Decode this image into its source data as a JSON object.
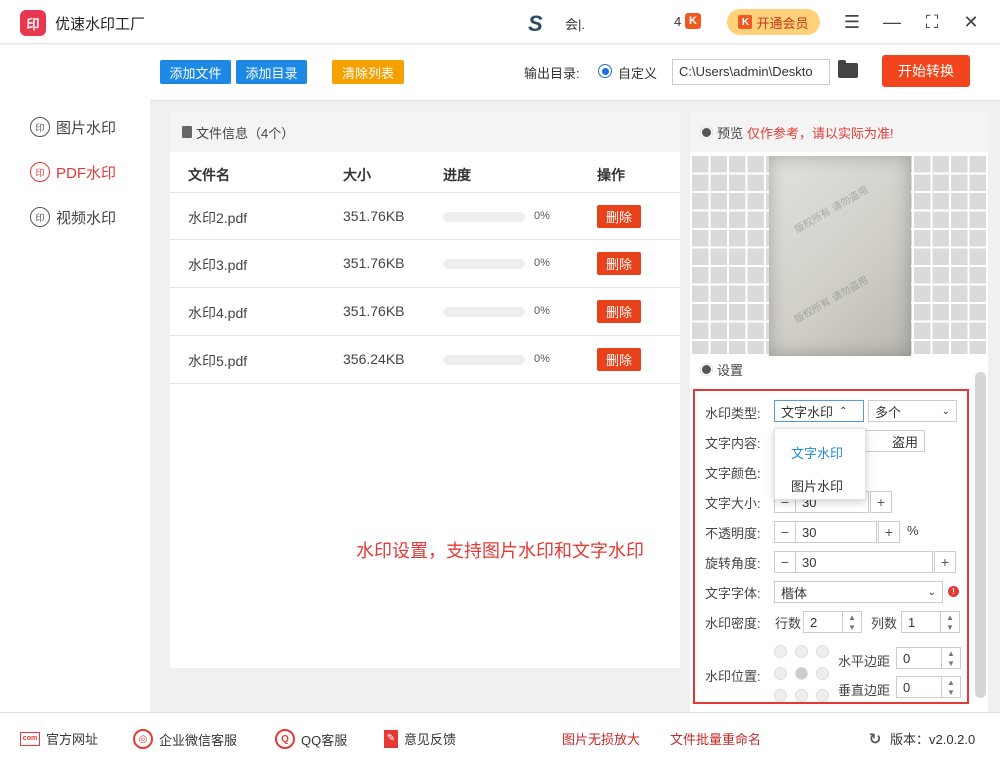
{
  "app": {
    "title": "优速水印工厂",
    "logo_glyph": "印",
    "user_name": "会|.",
    "vip_count": "4",
    "vip_button": "开通会员"
  },
  "sidebar": {
    "items": [
      {
        "label": "图片水印",
        "icon": "印",
        "active": false
      },
      {
        "label": "PDF水印",
        "icon": "印",
        "active": true
      },
      {
        "label": "视频水印",
        "icon": "印",
        "active": false
      }
    ]
  },
  "toolbar": {
    "add_file": "添加文件",
    "add_dir": "添加目录",
    "clear_list": "清除列表",
    "output_label": "输出目录:",
    "custom_label": "自定义",
    "output_path": "C:\\Users\\admin\\Deskto",
    "start": "开始转换"
  },
  "files": {
    "header": "文件信息（4个）",
    "columns": [
      "文件名",
      "大小",
      "进度",
      "操作"
    ],
    "rows": [
      {
        "name": "水印2.pdf",
        "size": "351.76KB",
        "progress": 0,
        "progress_text": "0%",
        "action": "删除"
      },
      {
        "name": "水印3.pdf",
        "size": "351.76KB",
        "progress": 0,
        "progress_text": "0%",
        "action": "删除"
      },
      {
        "name": "水印4.pdf",
        "size": "351.76KB",
        "progress": 0,
        "progress_text": "0%",
        "action": "删除"
      },
      {
        "name": "水印5.pdf",
        "size": "356.24KB",
        "progress": 0,
        "progress_text": "0%",
        "action": "删除"
      }
    ],
    "overlay_note": "水印设置，支持图片水印和文字水印"
  },
  "preview": {
    "label": "预览",
    "warning": "仅作参考，请以实际为准!",
    "watermark_text": "版权所有 请勿盗用"
  },
  "settings": {
    "header": "设置",
    "type_label": "水印类型:",
    "type_value": "文字水印",
    "multi_value": "多个",
    "type_options": [
      "文字水印",
      "图片水印"
    ],
    "content_label": "文字内容:",
    "content_value": "盗用",
    "color_label": "文字颜色:",
    "size_label": "文字大小:",
    "size_value": "30",
    "opacity_label": "不透明度:",
    "opacity_value": "30",
    "opacity_unit": "%",
    "rotation_label": "旋转角度:",
    "rotation_value": "30",
    "font_label": "文字字体:",
    "font_value": "楷体",
    "density_label": "水印密度:",
    "rows_label": "行数",
    "rows_value": "2",
    "cols_label": "列数",
    "cols_value": "1",
    "position_label": "水印位置:",
    "hmargin_label": "水平边距",
    "hmargin_value": "0",
    "vmargin_label": "垂直边距",
    "vmargin_value": "0"
  },
  "footer": {
    "website": "官方网址",
    "wechat": "企业微信客服",
    "qq": "QQ客服",
    "feedback": "意见反馈",
    "link1": "图片无损放大",
    "link2": "文件批量重命名",
    "version": "版本：v2.0.2.0"
  },
  "colors": {
    "accent_blue": "#1e88e5",
    "orange": "#f5a000",
    "red": "#e53935",
    "start_red": "#f1461d"
  }
}
